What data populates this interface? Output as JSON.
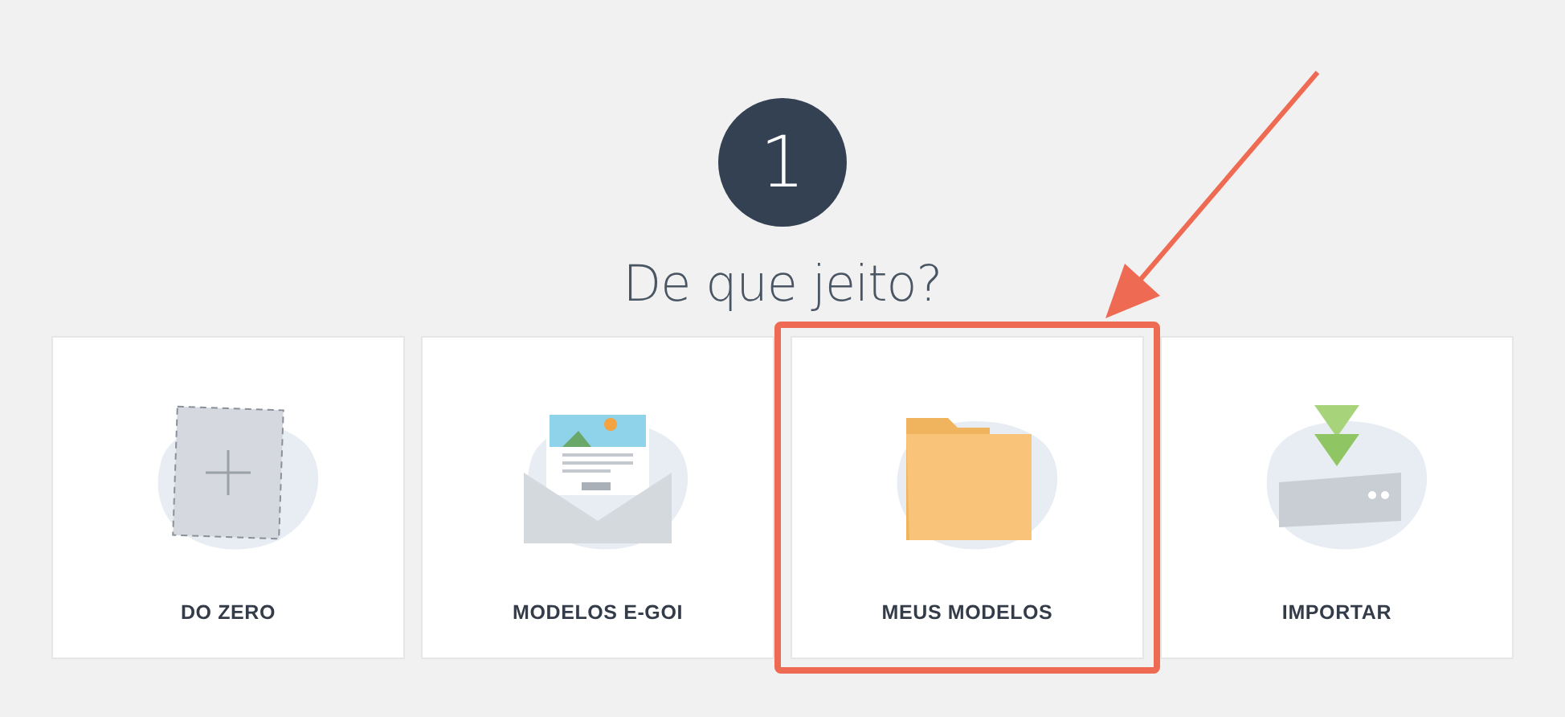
{
  "step": {
    "number": "1",
    "title": "De que jeito?"
  },
  "cards": [
    {
      "kind": "blank",
      "label": "DO ZERO",
      "highlighted": false
    },
    {
      "kind": "template",
      "label": "MODELOS E-GOI",
      "highlighted": false
    },
    {
      "kind": "folder",
      "label": "MEUS MODELOS",
      "highlighted": true
    },
    {
      "kind": "import",
      "label": "IMPORTAR",
      "highlighted": false
    }
  ]
}
